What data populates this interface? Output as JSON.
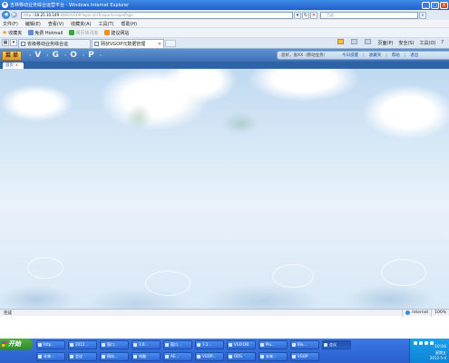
{
  "window": {
    "title": "吉林移动业务综合运营平台 - Windows Internet Explorer",
    "minimize": "_",
    "maximize": "□",
    "close": "X"
  },
  "address": {
    "prefix": "http://",
    "host": "10.25.10.149",
    "path": ":8080/VGOP/login.do?forward=loginPage",
    "search_placeholder": "百度"
  },
  "menu": [
    "文件(F)",
    "编辑(E)",
    "查看(V)",
    "收藏夹(A)",
    "工具(T)",
    "帮助(H)"
  ],
  "favorites": {
    "label": "收藏夹",
    "items": [
      "免费 Hotmail",
      "网页快讯库",
      "建议网站"
    ]
  },
  "tabs": [
    {
      "label": "省级移动业务综合运",
      "active": false
    },
    {
      "label": "网状VGOP元数据管理",
      "active": true
    }
  ],
  "tab_tools": {
    "page": "页面(P)",
    "safety": "安全(S)",
    "tools": "工具(O)"
  },
  "app": {
    "menu_label": "菜 单",
    "brand_letters": [
      "V",
      "G",
      "O",
      "P"
    ],
    "user_text": "您好，张XX（移动业务）",
    "links": [
      "今日提醒",
      "收藏夹",
      "帮助",
      "退出"
    ],
    "home_tab": "首页"
  },
  "status": {
    "left": "完成",
    "zone": "Internet",
    "zoom": "100%"
  },
  "taskbar": {
    "start": "开始",
    "row1": [
      "http...",
      "2012...",
      "窗口...",
      "3.0...",
      "窗口...",
      "3 2...",
      "VGO·DB",
      "Plu...",
      "Blo...",
      "会议"
    ],
    "row2": [
      "未来...",
      "会议",
      "网站...",
      "电脑",
      "AE...",
      "VGOP...",
      "ODS",
      "未来...",
      "VGOP"
    ],
    "clock": "10:04",
    "weekday": "星期五",
    "date": "2012-5-4"
  },
  "colors": {
    "title_bar": "#1f5fc8",
    "app_header": "#3f71b6",
    "menu_chip": "#d99a2e",
    "taskbar": "#2a5fcc",
    "start_button": "#2f8a2a",
    "content_sky": "#d6e7f6"
  }
}
